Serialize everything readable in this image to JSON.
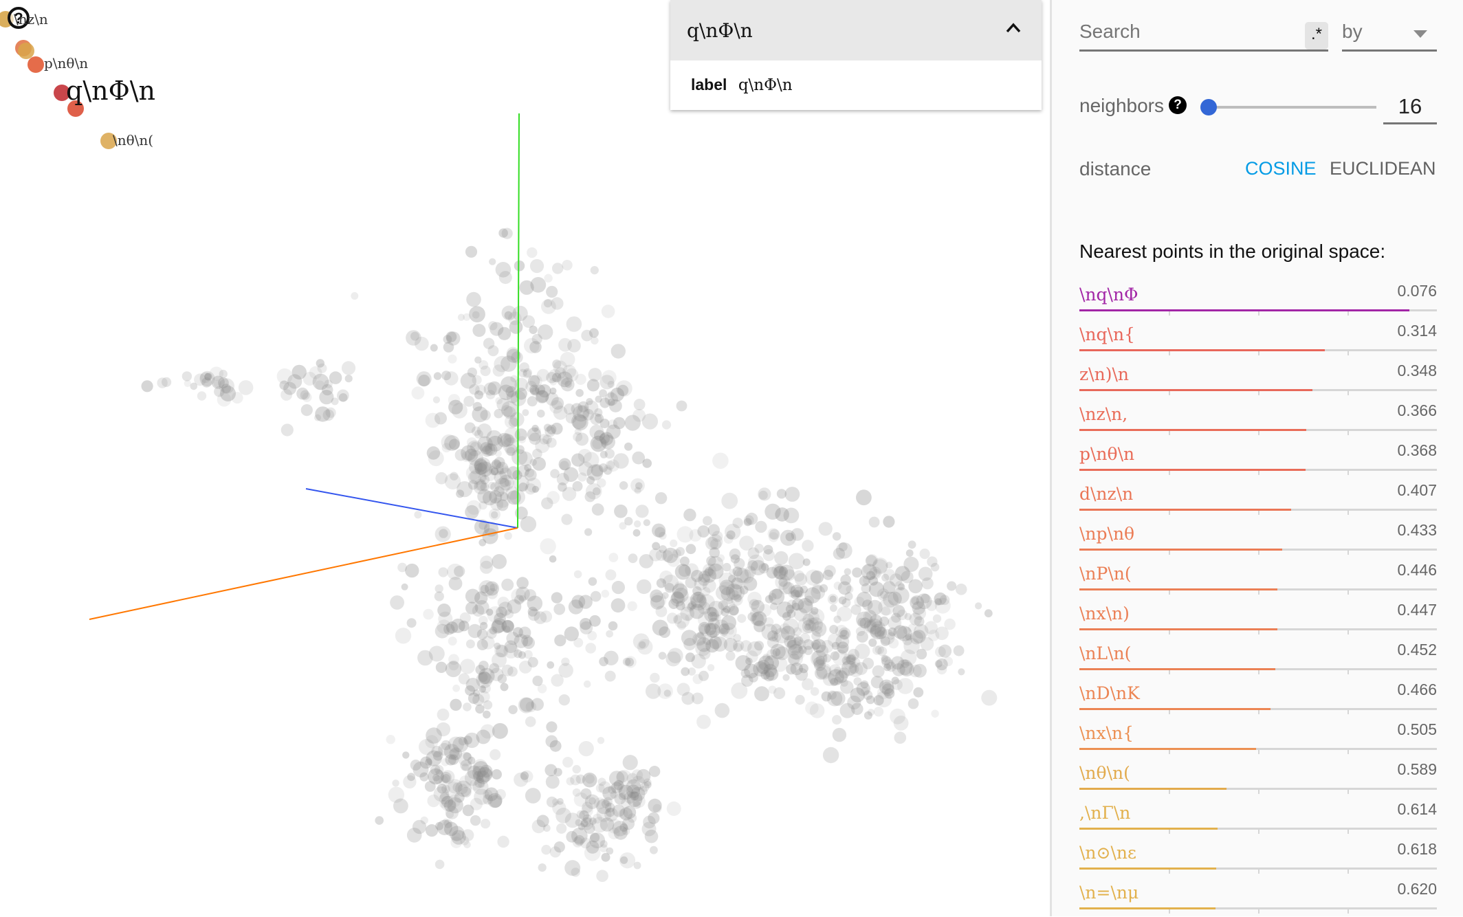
{
  "projector": {
    "help_icon": "help-circle-icon",
    "selected_point_label": "q\\nΦ\\n",
    "floating_labels": [
      {
        "text": "\\nz\\n",
        "color": "#d4a040"
      },
      {
        "text": "p\\nθ\\n",
        "color": "#e0522a"
      },
      {
        "text": "q\\nΦ\\n",
        "color": "#c0262c"
      },
      {
        "text": "\\nθ\\n(",
        "color": "#d9a54a"
      }
    ],
    "axes_colors": {
      "x": "#ff7700",
      "y": "#33dd22",
      "z": "#3355ee"
    }
  },
  "inspector_card": {
    "title": "q\\nΦ\\n",
    "collapse_icon": "chevron-up-icon",
    "field_name": "label",
    "field_value": "q\\nΦ\\n"
  },
  "panel": {
    "search_placeholder": "Search",
    "search_value": "",
    "regex_label": ".*",
    "by_label": "by",
    "neighbors_label": "neighbors",
    "neighbors_value": "16",
    "neighbors_fraction": 0.0,
    "distance_label": "distance",
    "distance_options": [
      "COSINE",
      "EUCLIDEAN"
    ],
    "distance_selected": "COSINE",
    "accent_color": "#039be5",
    "nearest_heading": "Nearest points in the original space:",
    "nearest": [
      {
        "label": "\\nq\\nΦ",
        "value": "0.076",
        "color": "#a225a6"
      },
      {
        "label": "\\nq\\n{",
        "value": "0.314",
        "color": "#e8665a"
      },
      {
        "label": "z\\n)\\n",
        "value": "0.348",
        "color": "#e8695a"
      },
      {
        "label": "\\nz\\n,",
        "value": "0.366",
        "color": "#e96c58"
      },
      {
        "label": "p\\nθ\\n",
        "value": "0.368",
        "color": "#e96c58"
      },
      {
        "label": "d\\nz\\n",
        "value": "0.407",
        "color": "#ea7656"
      },
      {
        "label": "\\np\\nθ",
        "value": "0.433",
        "color": "#eb7c55"
      },
      {
        "label": "\\nP\\n(",
        "value": "0.446",
        "color": "#eb7f55"
      },
      {
        "label": "\\nx\\n)",
        "value": "0.447",
        "color": "#eb7f55"
      },
      {
        "label": "\\nL\\n(",
        "value": "0.452",
        "color": "#eb8154"
      },
      {
        "label": "\\nD\\nK",
        "value": "0.466",
        "color": "#ec8553"
      },
      {
        "label": "\\nx\\n{",
        "value": "0.505",
        "color": "#ec9052"
      },
      {
        "label": "\\nθ\\n(",
        "value": "0.589",
        "color": "#e2aa4c"
      },
      {
        "label": ",\\nΓ\\n",
        "value": "0.614",
        "color": "#e2b04c"
      },
      {
        "label": "\\n⊙\\nε",
        "value": "0.618",
        "color": "#e2b04c"
      },
      {
        "label": "\\n=\\nμ",
        "value": "0.620",
        "color": "#e2b14c"
      }
    ]
  }
}
